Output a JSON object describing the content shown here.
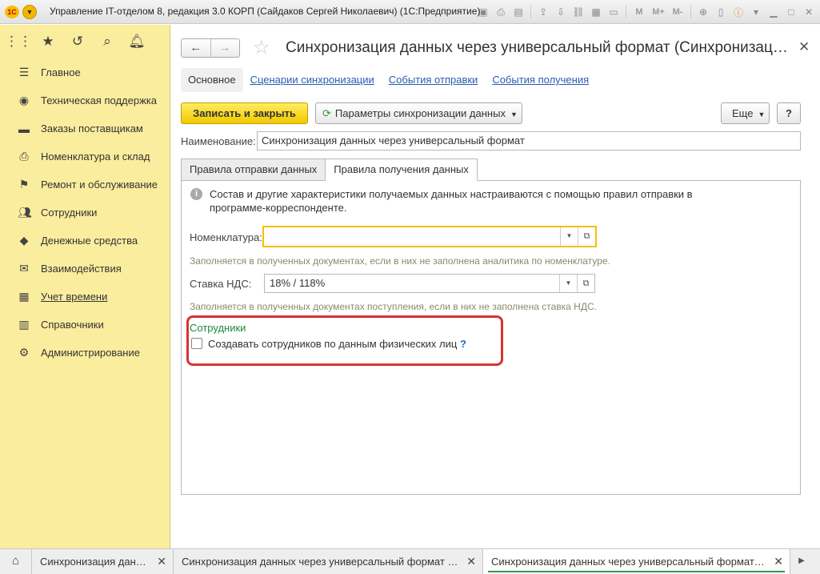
{
  "window": {
    "logo_text": "1C",
    "title": "Управление IT-отделом 8, редакция 3.0 КОРП (Сайдаков Сергей Николаевич)  (1С:Предприятие)",
    "toolbar_text_icons": [
      "M",
      "M+",
      "M-"
    ]
  },
  "sidebar": {
    "items": [
      {
        "label": "Главное",
        "icon": "hamburger-icon"
      },
      {
        "label": "Техническая поддержка",
        "icon": "lifebuoy-icon"
      },
      {
        "label": "Заказы поставщикам",
        "icon": "truck-icon"
      },
      {
        "label": "Номенклатура и склад",
        "icon": "printer-icon"
      },
      {
        "label": "Ремонт и обслуживание",
        "icon": "wrench-icon"
      },
      {
        "label": "Сотрудники",
        "icon": "people-icon"
      },
      {
        "label": "Денежные средства",
        "icon": "money-bag-icon"
      },
      {
        "label": "Взаимодействия",
        "icon": "envelope-icon"
      },
      {
        "label": "Учет времени",
        "icon": "calendar-icon"
      },
      {
        "label": "Справочники",
        "icon": "books-icon"
      },
      {
        "label": "Администрирование",
        "icon": "gear-icon"
      }
    ]
  },
  "form": {
    "title": "Синхронизация данных через универсальный формат (Синхронизация данных через универсальный формат)",
    "subtabs": [
      "Основное",
      "Сценарии синхронизации",
      "События отправки",
      "События получения"
    ],
    "save_close_label": "Записать и закрыть",
    "params_label": "Параметры синхронизации данных",
    "more_label": "Еще",
    "help_label": "?",
    "name_label": "Наименование:",
    "name_value": "Синхронизация данных через универсальный формат",
    "tabs": [
      "Правила отправки данных",
      "Правила получения данных"
    ],
    "info_text": "Состав и другие характеристики получаемых данных настраиваются с помощью правил отправки в программе-корреспонденте.",
    "nomenclature_label": "Номенклатура:",
    "nomenclature_value": "",
    "nomenclature_hint": "Заполняется в полученных документах, если в них не заполнена аналитика по номенклатуре.",
    "vat_label": "Ставка НДС:",
    "vat_value": "18% / 118%",
    "vat_hint": "Заполняется в полученных документах поступления, если в них не заполнена ставка НДС.",
    "employees_group": "Сотрудники",
    "create_employees_label": "Создавать сотрудников по данным физических лиц",
    "create_employees_checked": false,
    "create_employees_help": "?"
  },
  "windows_bar": {
    "tabs": [
      {
        "label": "Синхронизация данных",
        "active": false
      },
      {
        "label": "Синхронизация данных через универсальный формат Е...",
        "active": false
      },
      {
        "label": "Синхронизация данных через универсальный формат (...",
        "active": true
      }
    ]
  },
  "colors": {
    "sidebar_bg": "#fbed9e",
    "primary_button": "#f2c800",
    "group_title": "#1c8a3c",
    "highlight": "#d93333",
    "link": "#2a5db0"
  }
}
